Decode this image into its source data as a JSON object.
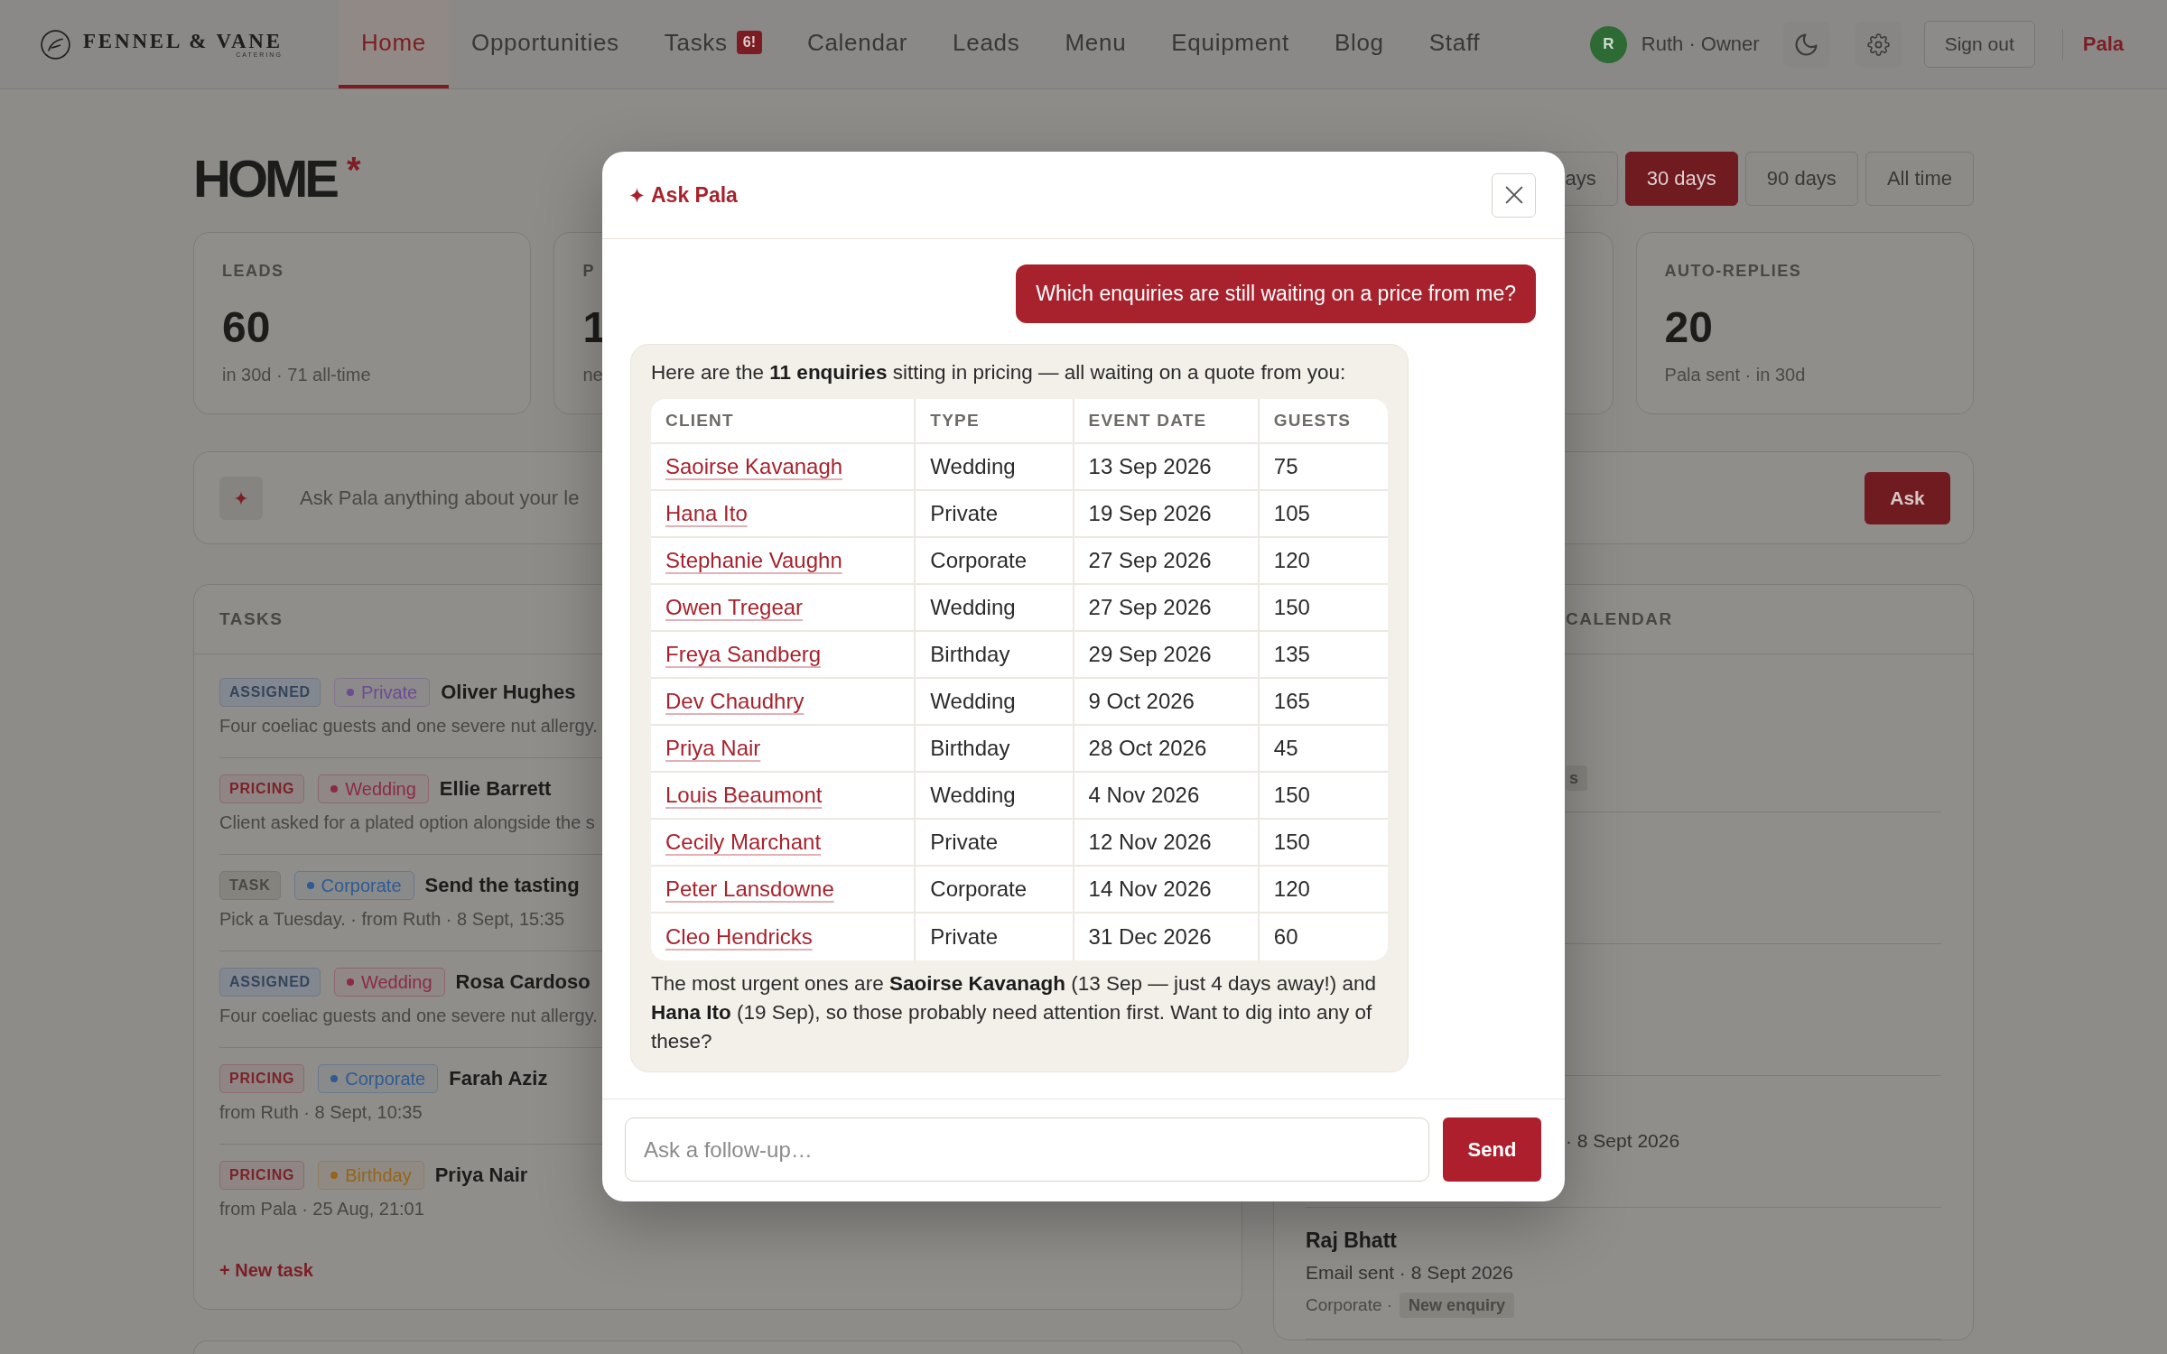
{
  "nav": {
    "brand": {
      "name": "FENNEL & VANE",
      "tagline": "CATERING"
    },
    "tabs": [
      {
        "label": "Home",
        "selected": true
      },
      {
        "label": "Opportunities",
        "selected": false
      },
      {
        "label": "Tasks",
        "selected": false,
        "badge": "6!"
      },
      {
        "label": "Calendar",
        "selected": false
      },
      {
        "label": "Leads",
        "selected": false
      },
      {
        "label": "Menu",
        "selected": false
      },
      {
        "label": "Equipment",
        "selected": false
      },
      {
        "label": "Blog",
        "selected": false
      },
      {
        "label": "Staff",
        "selected": false
      }
    ],
    "user": {
      "initial": "R",
      "label": "Ruth · Owner"
    },
    "sign_out": "Sign out",
    "assistant": "Pala"
  },
  "home": {
    "title": "HOME",
    "title_mark": "*",
    "ranges": [
      {
        "label": "ays",
        "selected": false
      },
      {
        "label": "30 days",
        "selected": true
      },
      {
        "label": "90 days",
        "selected": false
      },
      {
        "label": "All time",
        "selected": false
      }
    ],
    "stats": [
      {
        "label": "LEADS",
        "value": "60",
        "note": "in 30d · 71 all-time"
      },
      {
        "label": "P",
        "value": "1",
        "note": "ne"
      },
      {
        "label": "AUTO-REPLIES",
        "value": "20",
        "note": "Pala sent · in 30d"
      }
    ],
    "ask_bar": {
      "placeholder": "Ask Pala anything about your le",
      "button": "Ask"
    },
    "tasks": {
      "title": "TASKS",
      "items": [
        {
          "status": {
            "label": "ASSIGNED",
            "kind": "assigned"
          },
          "tag": {
            "label": "Private",
            "color": "#6c4b93"
          },
          "title": "Oliver Hughes",
          "detail": "Four coeliac guests and one severe nut allergy."
        },
        {
          "status": {
            "label": "PRICING",
            "kind": "pricing"
          },
          "tag": {
            "label": "Wedding",
            "color": "#8c2a45"
          },
          "title": "Ellie Barrett",
          "detail": "Client asked for a plated option alongside the s"
        },
        {
          "status": {
            "label": "TASK",
            "kind": "task"
          },
          "tag": {
            "label": "Corporate",
            "color": "#2f5a93"
          },
          "title": "Send the tasting",
          "detail": "Pick a Tuesday. · from Ruth · 8 Sept, 15:35"
        },
        {
          "status": {
            "label": "ASSIGNED",
            "kind": "assigned"
          },
          "tag": {
            "label": "Wedding",
            "color": "#8c2a45"
          },
          "title": "Rosa Cardoso",
          "detail": "Four coeliac guests and one severe nut allergy."
        },
        {
          "status": {
            "label": "PRICING",
            "kind": "pricing"
          },
          "tag": {
            "label": "Corporate",
            "color": "#2f5a93"
          },
          "title": "Farah Aziz",
          "detail": "from Ruth · 8 Sept, 10:35"
        },
        {
          "status": {
            "label": "PRICING",
            "kind": "pricing"
          },
          "tag": {
            "label": "Birthday",
            "color": "#96641a"
          },
          "title": "Priya Nair",
          "detail": "from Pala · 25 Aug, 21:01"
        }
      ],
      "new_task": "+ New task"
    },
    "calendar": {
      "title": "CALENDAR",
      "items": [
        {
          "partly_hidden": true,
          "tag": "s"
        },
        {
          "partly_hidden": true,
          "detail": "· 8 Sept 2026"
        },
        {
          "name": "Raj Bhatt",
          "detail": "Email sent · 8 Sept 2026",
          "category": "Corporate ·",
          "tag": "New enquiry"
        }
      ]
    }
  },
  "dialog": {
    "title": "Ask Pala",
    "messages": [
      {
        "kind": "user",
        "text": "Which enquiries are still waiting on a price from me?"
      },
      {
        "kind": "assistant",
        "intro": "Here are the **11 enquiries** sitting in pricing — all waiting on a quote from you:",
        "table": {
          "columns": [
            "CLIENT",
            "TYPE",
            "EVENT DATE",
            "GUESTS"
          ],
          "rows": [
            [
              "Saoirse Kavanagh",
              "Wedding",
              "13 Sep 2026",
              "75"
            ],
            [
              "Hana Ito",
              "Private",
              "19 Sep 2026",
              "105"
            ],
            [
              "Stephanie Vaughn",
              "Corporate",
              "27 Sep 2026",
              "120"
            ],
            [
              "Owen Tregear",
              "Wedding",
              "27 Sep 2026",
              "150"
            ],
            [
              "Freya Sandberg",
              "Birthday",
              "29 Sep 2026",
              "135"
            ],
            [
              "Dev Chaudhry",
              "Wedding",
              "9 Oct 2026",
              "165"
            ],
            [
              "Priya Nair",
              "Birthday",
              "28 Oct 2026",
              "45"
            ],
            [
              "Louis Beaumont",
              "Wedding",
              "4 Nov 2026",
              "150"
            ],
            [
              "Cecily Marchant",
              "Private",
              "12 Nov 2026",
              "150"
            ],
            [
              "Peter Lansdowne",
              "Corporate",
              "14 Nov 2026",
              "120"
            ],
            [
              "Cleo Hendricks",
              "Private",
              "31 Dec 2026",
              "60"
            ]
          ]
        },
        "outro": "The most urgent ones are **Saoirse Kavanagh** (13 Sep — just 4 days away!) and **Hana Ito** (19 Sep), so those probably need attention first. Want to dig into any of these?"
      }
    ],
    "input": {
      "placeholder": "Ask a follow-up…"
    },
    "send": "Send"
  }
}
